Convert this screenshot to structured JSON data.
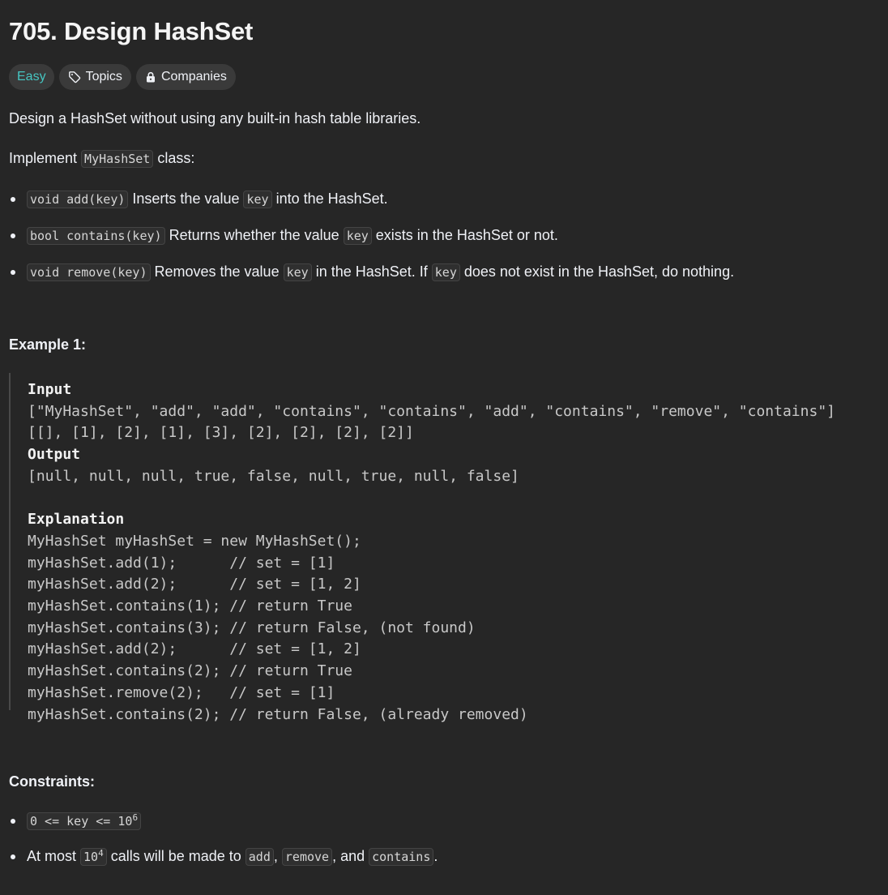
{
  "problem": {
    "title": "705. Design HashSet",
    "difficulty": "Easy",
    "topics_label": "Topics",
    "companies_label": "Companies",
    "description": "Design a HashSet without using any built-in hash table libraries.",
    "implement_prefix": "Implement ",
    "implement_class": "MyHashSet",
    "implement_suffix": " class:"
  },
  "methods": [
    {
      "signature": "void add(key)",
      "text1": " Inserts the value ",
      "code1": "key",
      "text2": " into the HashSet."
    },
    {
      "signature": "bool contains(key)",
      "text1": " Returns whether the value ",
      "code1": "key",
      "text2": " exists in the HashSet or not."
    },
    {
      "signature": "void remove(key)",
      "text1": " Removes the value ",
      "code1": "key",
      "text2": " in the HashSet. If ",
      "code2": "key",
      "text3": " does not exist in the HashSet, do nothing."
    }
  ],
  "example": {
    "heading": "Example 1:",
    "input_label": "Input",
    "input_line1": "[\"MyHashSet\", \"add\", \"add\", \"contains\", \"contains\", \"add\", \"contains\", \"remove\", \"contains\"]",
    "input_line2": "[[], [1], [2], [1], [3], [2], [2], [2], [2]]",
    "output_label": "Output",
    "output_line": "[null, null, null, true, false, null, true, null, false]",
    "explanation_label": "Explanation",
    "explanation_lines": [
      "MyHashSet myHashSet = new MyHashSet();",
      "myHashSet.add(1);      // set = [1]",
      "myHashSet.add(2);      // set = [1, 2]",
      "myHashSet.contains(1); // return True",
      "myHashSet.contains(3); // return False, (not found)",
      "myHashSet.add(2);      // set = [1, 2]",
      "myHashSet.contains(2); // return True",
      "myHashSet.remove(2);   // set = [1]",
      "myHashSet.contains(2); // return False, (already removed)"
    ]
  },
  "constraints": {
    "heading": "Constraints:",
    "c1_code": "0 <= key <= 10",
    "c1_sup": "6",
    "c2_prefix": "At most ",
    "c2_code": "10",
    "c2_sup": "4",
    "c2_mid": " calls will be made to ",
    "c2_code_add": "add",
    "c2_sep1": ", ",
    "c2_code_remove": "remove",
    "c2_sep2": ", and ",
    "c2_code_contains": "contains",
    "c2_end": "."
  },
  "colors": {
    "background": "#262626",
    "text": "#eff1f6",
    "easy": "#46c6c2",
    "tag_bg": "#3a3a3a"
  },
  "icons": {
    "topics": "tag-icon",
    "companies": "lock-icon"
  }
}
